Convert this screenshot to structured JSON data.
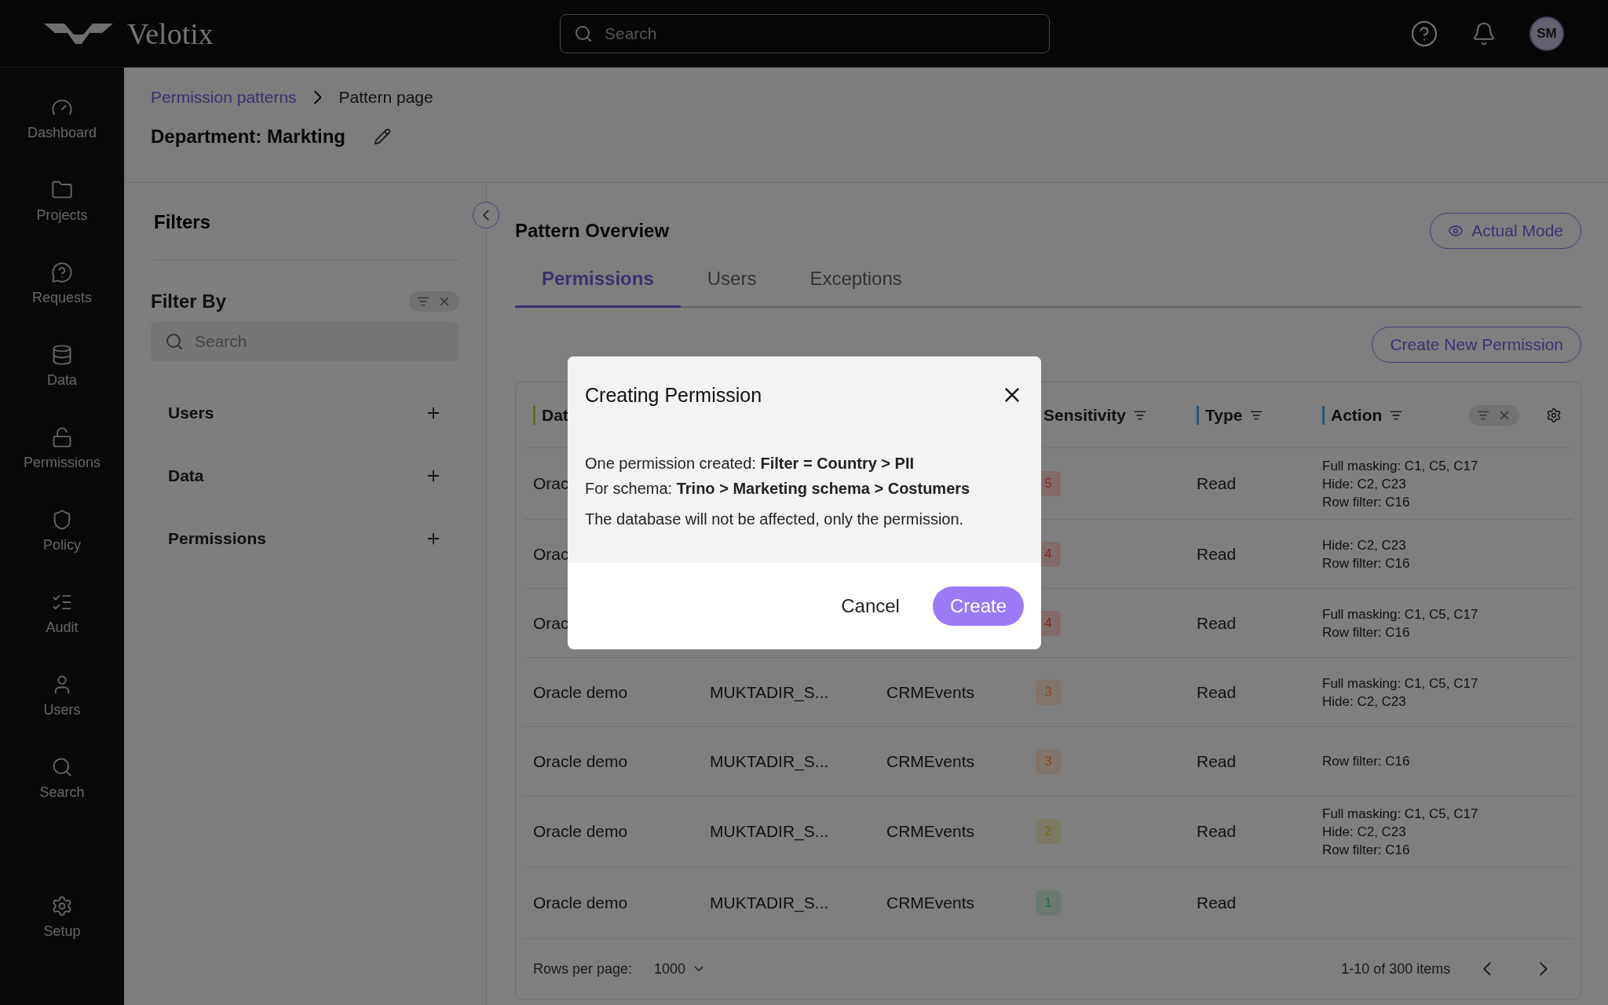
{
  "app": {
    "name": "Velotix"
  },
  "search": {
    "placeholder": "Search"
  },
  "user": {
    "initials": "SM"
  },
  "nav": [
    {
      "label": "Dashboard",
      "kind": "dashboard"
    },
    {
      "label": "Projects",
      "kind": "projects"
    },
    {
      "label": "Requests",
      "kind": "requests"
    },
    {
      "label": "Data",
      "kind": "data"
    },
    {
      "label": "Permissions",
      "kind": "permissions"
    },
    {
      "label": "Policy",
      "kind": "policy"
    },
    {
      "label": "Audit",
      "kind": "audit"
    },
    {
      "label": "Users",
      "kind": "users"
    },
    {
      "label": "Search",
      "kind": "search"
    },
    {
      "label": "Setup",
      "kind": "setup"
    }
  ],
  "breadcrumb": [
    "Permission patterns",
    "Pattern page"
  ],
  "page_title": "Department: Markting",
  "filters": {
    "title": "Filters",
    "filter_by": "Filter By",
    "search_placeholder": "Search",
    "groups": [
      "Users",
      "Data",
      "Permissions"
    ]
  },
  "overview": {
    "title": "Pattern Overview",
    "mode_button": "Actual Mode",
    "create_button": "Create New Permission",
    "tabs": [
      {
        "label": "Permissions",
        "selected": true
      },
      {
        "label": "Users",
        "selected": false
      },
      {
        "label": "Exceptions",
        "selected": false
      }
    ]
  },
  "table": {
    "columns": [
      {
        "label": "Dat",
        "color": "#5d6a1d"
      },
      {
        "label": "Sensitivity"
      },
      {
        "label": "Type",
        "color": "#2c5573"
      },
      {
        "label": "Action",
        "color": "#2c5573"
      }
    ],
    "rows": [
      {
        "cells": [
          "Orac"
        ],
        "sensitivity": "5",
        "color": "#8a2420",
        "type": "Read",
        "action": [
          "Full masking: C1, C5, C17",
          "Hide: C2, C23",
          "Row filter: C16"
        ]
      },
      {
        "cells": [
          "Orac"
        ],
        "sensitivity": "4",
        "color": "#8a2420",
        "type": "Read",
        "action": [
          "Hide: C2, C23",
          "Row filter: C16"
        ]
      },
      {
        "cells": [
          "Orac"
        ],
        "sensitivity": "4",
        "color": "#8a2420",
        "type": "Read",
        "action": [
          "Full masking: C1, C5, C17",
          "Row filter: C16"
        ]
      },
      {
        "cells": [
          "Oracle demo",
          "MUKTADIR_S...",
          "CRMEvents"
        ],
        "sensitivity": "3",
        "color": "#8a4a1a",
        "type": "Read",
        "action": [
          "Full masking: C1, C5, C17",
          "Hide: C2, C23"
        ]
      },
      {
        "cells": [
          "Oracle demo",
          "MUKTADIR_S...",
          "CRMEvents"
        ],
        "sensitivity": "3",
        "color": "#8a4a1a",
        "type": "Read",
        "action": [
          "Row filter: C16"
        ]
      },
      {
        "cells": [
          "Oracle demo",
          "MUKTADIR_S...",
          "CRMEvents"
        ],
        "sensitivity": "2",
        "color": "#7a6a10",
        "type": "Read",
        "action": [
          "Full masking: C1, C5, C17",
          "Hide: C2, C23",
          "Row filter: C16"
        ]
      },
      {
        "cells": [
          "Oracle demo",
          "MUKTADIR_S...",
          "CRMEvents"
        ],
        "sensitivity": "1",
        "color": "#1d6b3e",
        "type": "Read",
        "action": []
      }
    ],
    "footer": {
      "rows_label": "Rows per page:",
      "rows_value": "1000",
      "range": "1-10 of 300 items"
    }
  },
  "dialog": {
    "title": "Creating Permission",
    "lines": [
      "One permission created: **Filter = Country > PII**",
      "For schema: **Trino > Marketing schema > Costumers**"
    ],
    "note": "The database will not be affected, only the permission.",
    "cancel": "Cancel",
    "confirm": "Create"
  }
}
